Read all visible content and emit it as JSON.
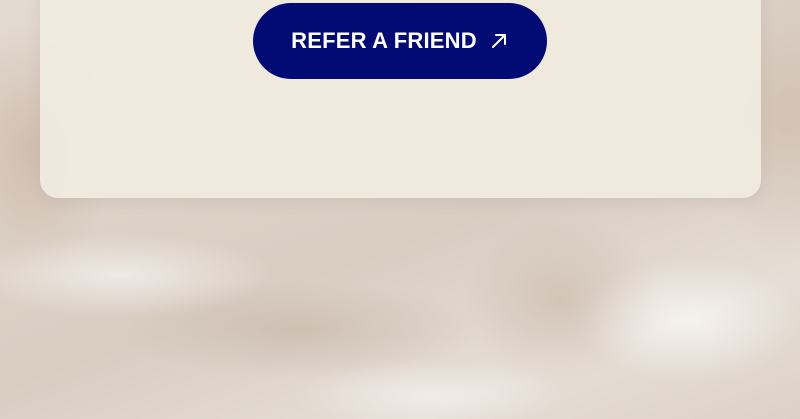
{
  "page": {
    "background": "silk-fabric-photo"
  },
  "card": {
    "background_color": "#f1ece0"
  },
  "cta": {
    "label": "REFER A FRIEND",
    "icon": "arrow-up-right-icon",
    "color": "#020b73",
    "text_color": "#ffffff"
  }
}
